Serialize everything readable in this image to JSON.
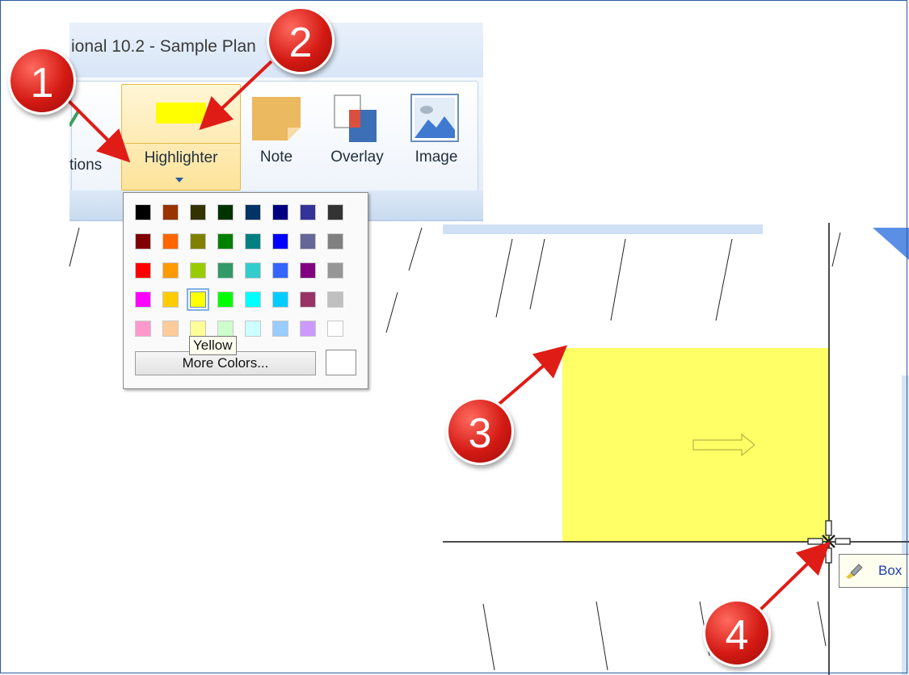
{
  "window": {
    "title_fragment": "ional 10.2 - Sample Plan"
  },
  "ribbon": {
    "options_label_fragment": "tions",
    "highlighter_label": "Highlighter",
    "highlighter_color": "#ffff00",
    "note_label": "Note",
    "overlay_label": "Overlay",
    "image_label": "Image"
  },
  "palette": {
    "rows": [
      [
        "#000000",
        "#993300",
        "#333300",
        "#003300",
        "#003366",
        "#000080",
        "#333399",
        "#333333"
      ],
      [
        "#800000",
        "#ff6600",
        "#808000",
        "#008000",
        "#008080",
        "#0000ff",
        "#666699",
        "#808080"
      ],
      [
        "#ff0000",
        "#ff9900",
        "#99cc00",
        "#339966",
        "#33cccc",
        "#3366ff",
        "#800080",
        "#969696"
      ],
      [
        "#ff00ff",
        "#ffcc00",
        "#ffff00",
        "#00ff00",
        "#00ffff",
        "#00ccff",
        "#993366",
        "#c0c0c0"
      ],
      [
        "#ff99cc",
        "#ffcc99",
        "#ffff99",
        "#ccffcc",
        "#ccffff",
        "#99ccff",
        "#cc99ff",
        "#ffffff"
      ]
    ],
    "selected_color": "#ffff00",
    "tooltip": "Yellow",
    "more_colors_label": "More Colors..."
  },
  "drawing": {
    "highlight_fill": "#ffff66",
    "box_tooltip_label": "Box"
  },
  "markers": [
    "1",
    "2",
    "3",
    "4"
  ],
  "colors": {
    "marker_red": "#d41a14",
    "arrow_red": "#e01c17"
  }
}
